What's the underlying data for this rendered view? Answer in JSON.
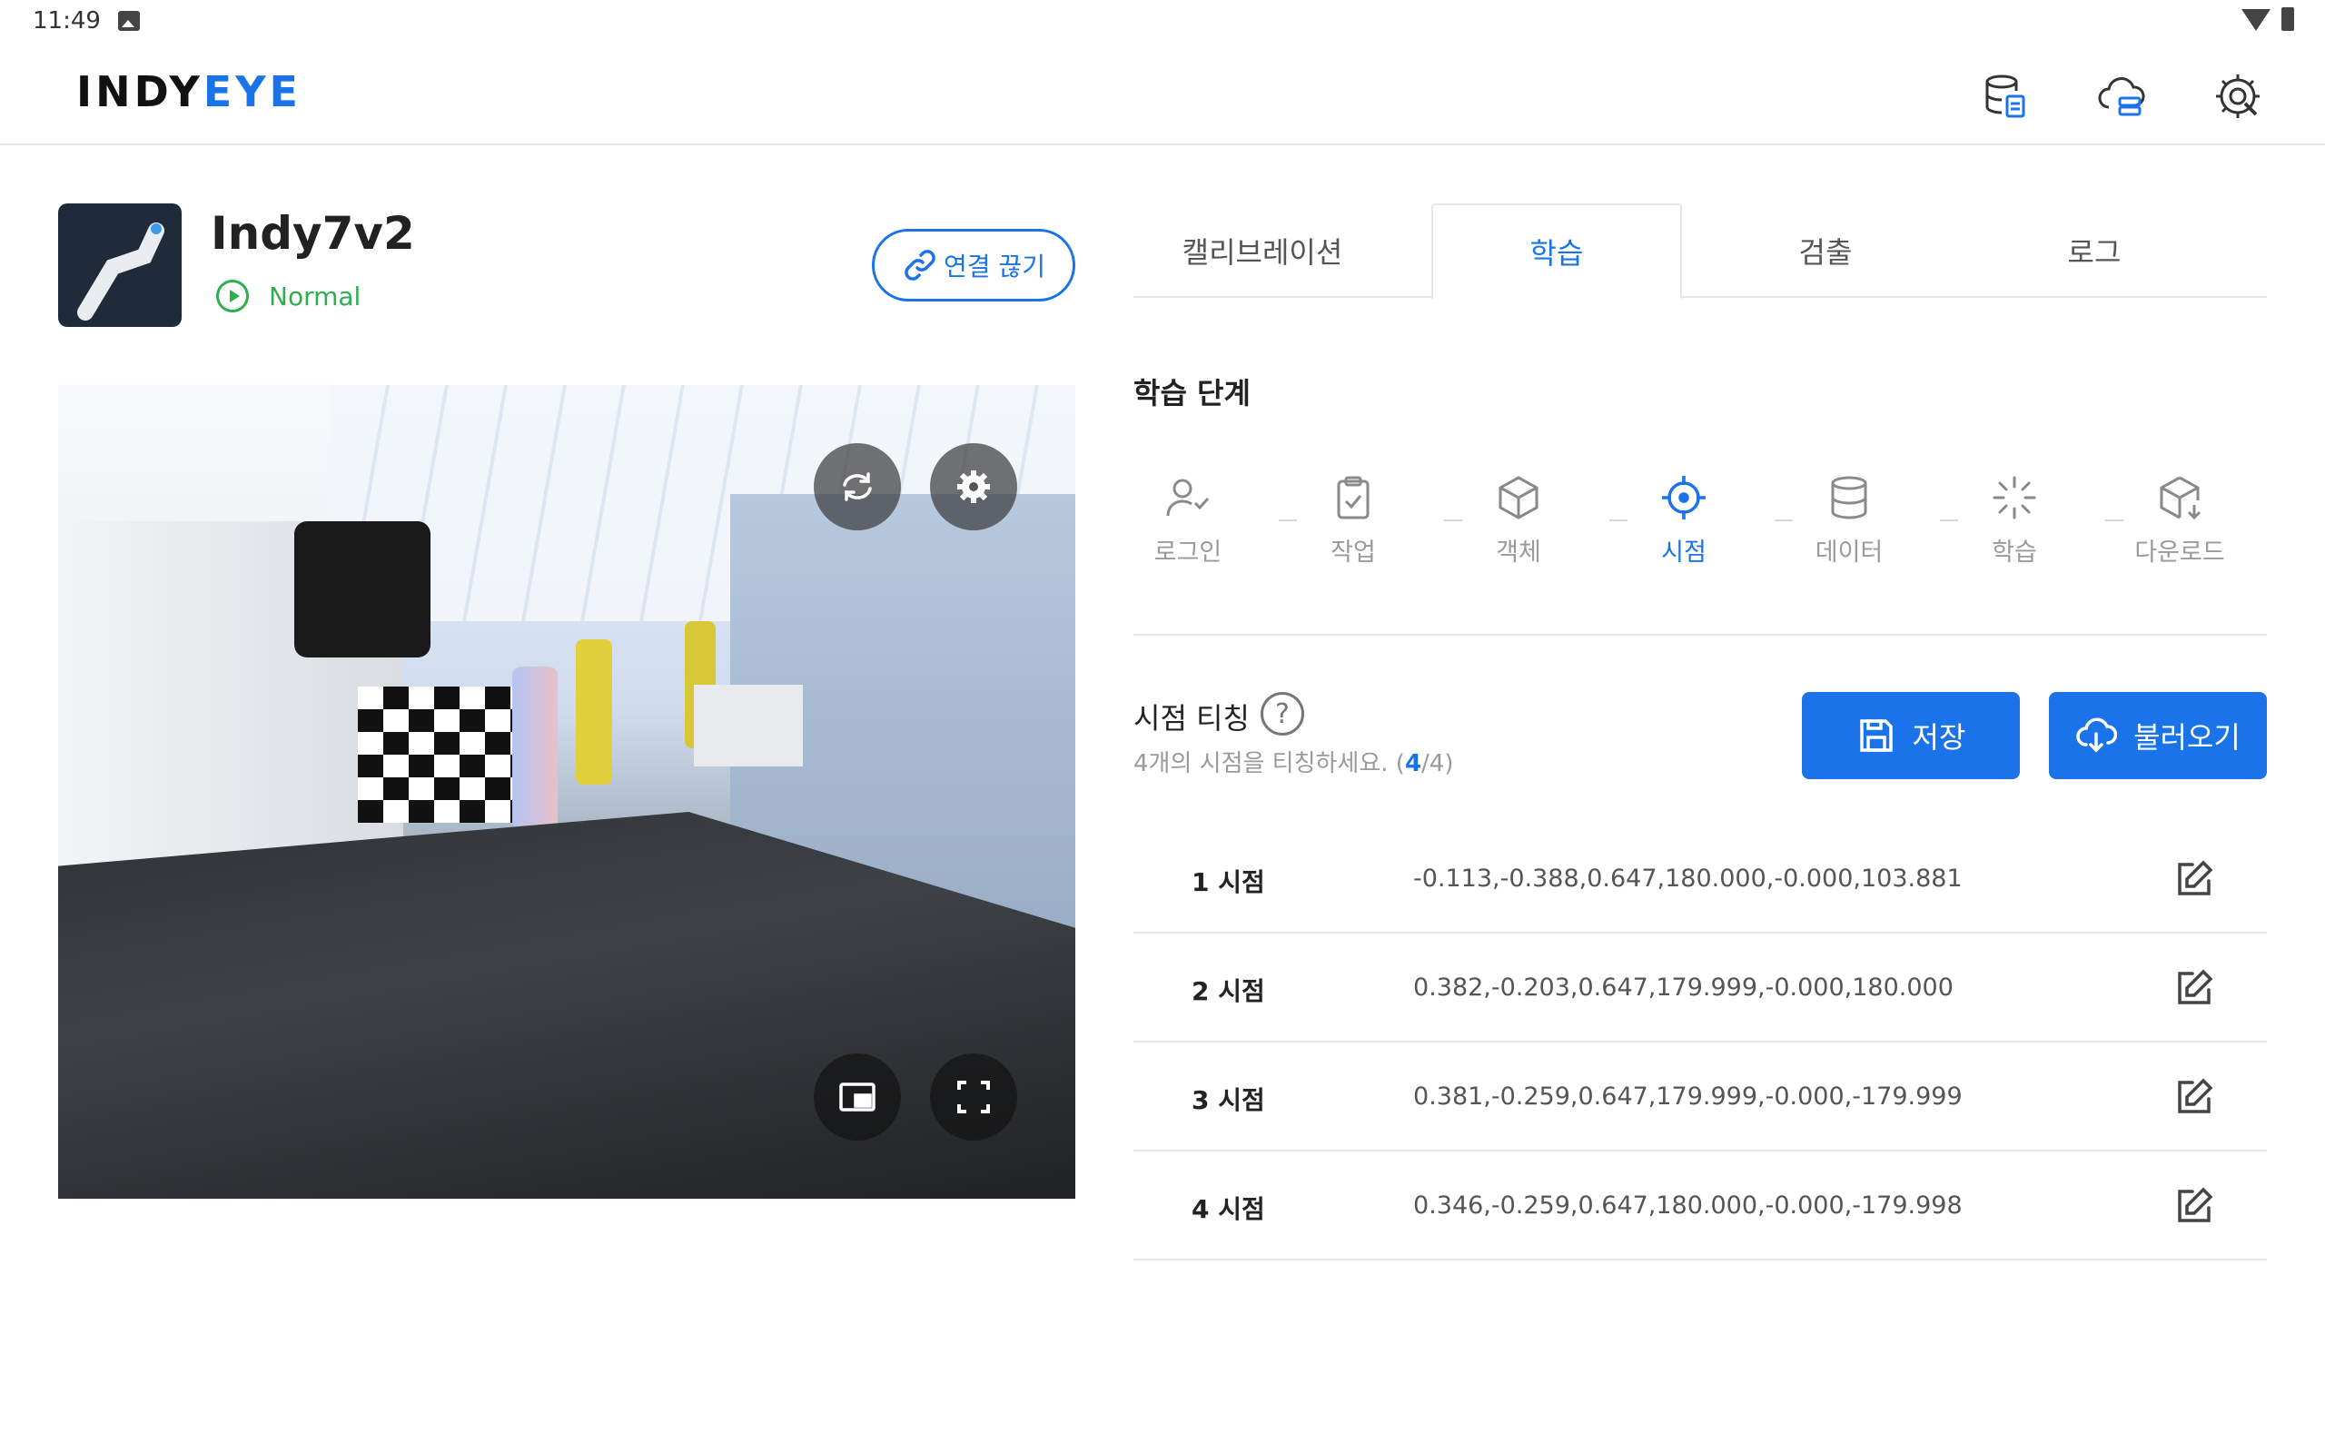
{
  "status_bar": {
    "time": "11:49"
  },
  "header": {
    "logo_main": "INDY",
    "logo_accent": "EYE",
    "icons": [
      "database-doc-icon",
      "cloud-storage-icon",
      "settings-tools-icon"
    ]
  },
  "device": {
    "name": "Indy7v2",
    "status": "Normal",
    "disconnect_label": "연결 끊기"
  },
  "camera": {
    "buttons": [
      "refresh-icon",
      "gear-icon",
      "picture-in-picture-icon",
      "fullscreen-icon"
    ]
  },
  "tabs": [
    {
      "label": "캘리브레이션",
      "active": false
    },
    {
      "label": "학습",
      "active": true
    },
    {
      "label": "검출",
      "active": false
    },
    {
      "label": "로그",
      "active": false
    }
  ],
  "learning": {
    "title": "학습 단계",
    "steps": [
      {
        "label": "로그인",
        "icon": "user-check-icon"
      },
      {
        "label": "작업",
        "icon": "clipboard-check-icon"
      },
      {
        "label": "객체",
        "icon": "cube-icon"
      },
      {
        "label": "시점",
        "icon": "crosshair-icon",
        "active": true
      },
      {
        "label": "데이터",
        "icon": "database-icon"
      },
      {
        "label": "학습",
        "icon": "loader-icon"
      },
      {
        "label": "다운로드",
        "icon": "box-download-icon"
      }
    ]
  },
  "viewpoint": {
    "title": "시점 티칭",
    "subtitle_prefix": "4개의 시점을 티칭하세요. (",
    "count_done": "4",
    "count_total": "/4)",
    "save_label": "저장",
    "load_label": "불러오기",
    "rows": [
      {
        "name": "1 시점",
        "value": "-0.113,-0.388,0.647,180.000,-0.000,103.881"
      },
      {
        "name": "2 시점",
        "value": "0.382,-0.203,0.647,179.999,-0.000,180.000"
      },
      {
        "name": "3 시점",
        "value": "0.381,-0.259,0.647,179.999,-0.000,-179.999"
      },
      {
        "name": "4 시점",
        "value": "0.346,-0.259,0.647,180.000,-0.000,-179.998"
      }
    ]
  },
  "colors": {
    "accent": "#1a73e8",
    "status_ok": "#2fae4e"
  }
}
